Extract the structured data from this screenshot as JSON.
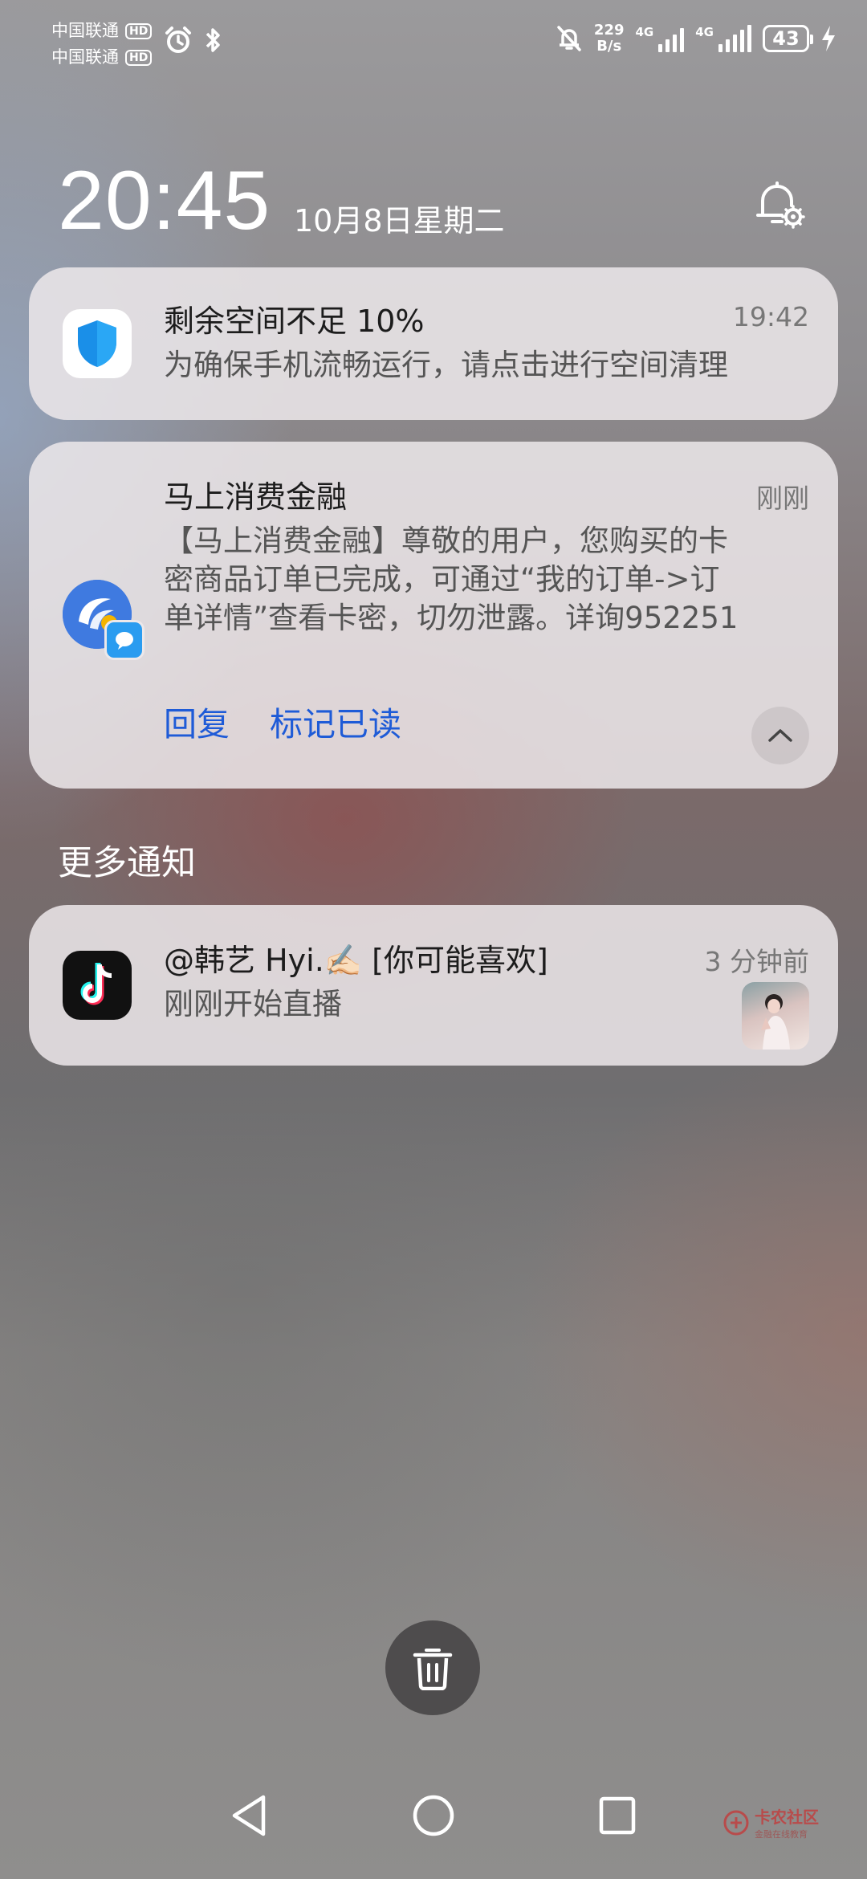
{
  "status_bar": {
    "carrier1": "中国联通",
    "carrier2": "中国联通",
    "hd_label": "HD",
    "net_speed_value": "229",
    "net_speed_unit": "B/s",
    "sim1_tech": "4G",
    "sim2_tech": "4G",
    "battery": "43",
    "icons": [
      "alarm-icon",
      "bluetooth-icon",
      "mute-notifications-icon",
      "signal-icon",
      "charging-icon"
    ]
  },
  "lockscreen": {
    "time": "20:45",
    "date": "10月8日星期二"
  },
  "notifications": [
    {
      "app": "phone-manager",
      "title": "剩余空间不足 10%",
      "time": "19:42",
      "body": "为确保手机流畅运行，请点击进行空间清理"
    },
    {
      "app": "messages",
      "title": "马上消费金融",
      "time": "刚刚",
      "body_line1": "【马上消费金融】尊敬的用户，您购买的卡",
      "body_line2": "密商品订单已完成，可通过“我的订单->订",
      "body_line3": "单详情”查看卡密，切勿泄露。详询952251",
      "actions": {
        "reply": "回复",
        "mark_read": "标记已读"
      }
    }
  ],
  "more_notifications_label": "更多通知",
  "more_notifications": [
    {
      "app": "tiktok",
      "title": "@韩艺 Hyi.✍🏻 [你可能喜欢]",
      "time": "3 分钟前",
      "body": "刚刚开始直播"
    }
  ],
  "watermark": {
    "name": "卡农社区",
    "sub": "金融在线教育"
  },
  "colors": {
    "action_blue": "#1e5bd7",
    "card_bg": "#ECE8EA",
    "shield_blue": "#1a8fe8"
  }
}
